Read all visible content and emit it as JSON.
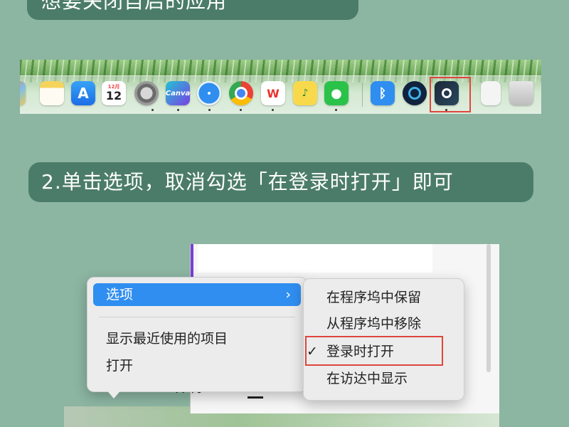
{
  "header": {
    "title_fragment": "想要关闭自启的应用"
  },
  "step2": {
    "text": "2.单击选项，取消勾选「在登录时打开」即可"
  },
  "dock": {
    "calendar_month": "12月",
    "calendar_day": "12",
    "canva_label": "Canva",
    "wps_label": "W",
    "icons": [
      "launchpad-icon",
      "notes-icon",
      "app-store-icon",
      "calendar-icon",
      "system-settings-icon",
      "canva-icon",
      "safari-icon",
      "chrome-icon",
      "wps-icon",
      "qq-music-icon",
      "wechat-icon",
      "bluetooth-icon",
      "network-icon",
      "steam-icon",
      "preview-icon",
      "trash-icon"
    ]
  },
  "menu": {
    "main_items": {
      "options": "选项",
      "chevron": "›",
      "recent": "显示最近使用的项目",
      "open": "打开"
    },
    "sub_items": {
      "keep_in_dock": "在程序坞中保留",
      "remove_from_dock": "从程序坞中移除",
      "open_at_login": "登录时打开",
      "show_in_finder": "在访达中显示",
      "checkmark": "✓"
    },
    "background_percent": "47%"
  },
  "colors": {
    "background": "#8cb5a2",
    "pill": "#4b7c69",
    "menu_highlight": "#2f8ef0",
    "annotation_box": "#e0463c"
  }
}
